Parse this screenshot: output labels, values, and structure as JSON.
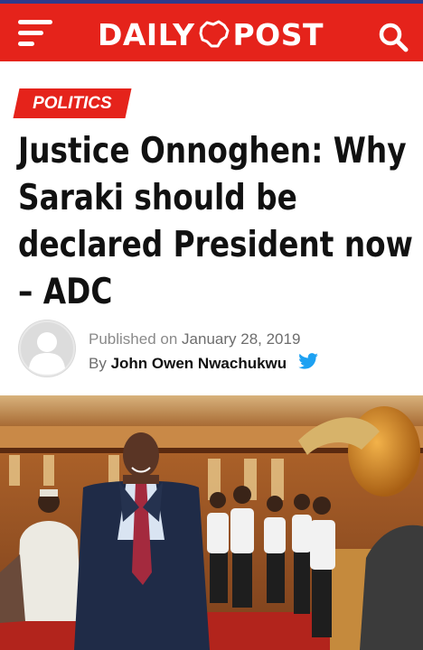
{
  "header": {
    "logo_left": "DAILY",
    "logo_right": "POST"
  },
  "colors": {
    "brand_red": "#e5231b",
    "top_line": "#2d3a8c",
    "twitter": "#1da1f2"
  },
  "icons": [
    "menu-icon",
    "search-icon",
    "nigeria-map-icon",
    "twitter-icon",
    "avatar-placeholder-icon"
  ],
  "article": {
    "category": "POLITICS",
    "title_lines": [
      "Justice Onnoghen: Why",
      "Saraki should be",
      "declared President now",
      "– ADC"
    ],
    "published_label": "Published on",
    "date": "January 28, 2019",
    "by_label": "By",
    "author": "John Owen Nwachukwu"
  }
}
